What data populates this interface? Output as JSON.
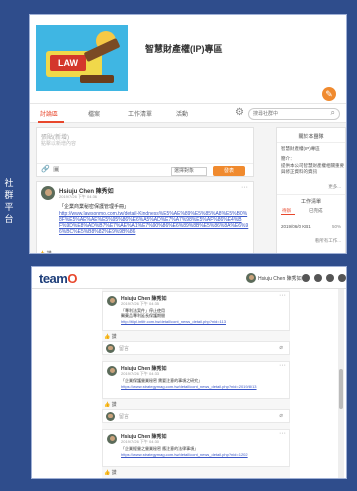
{
  "slide": {
    "side_caption": "社群平台"
  },
  "top": {
    "group_title": "智慧財產權(IP)專區",
    "tabs": [
      "討論區",
      "檔案",
      "工作清單",
      "活動"
    ],
    "search_placeholder": "搜尋社群中",
    "post_box": {
      "placeholder": "張貼(新增)",
      "sub_placeholder": "點擊以新增內容",
      "select_label": "選擇對象",
      "publish_label": "發表"
    },
    "feed_post": {
      "author": "Hsiuju Chen 陳秀如",
      "time": "2019/7/26 下午 04:36",
      "body": "「企業商業秘密保護管理手冊」",
      "link": "http://www.lawsonmo.com.tw/detail-Kindness%E5%AE%89%E5%85%A8%E5%B0%8F%E5%AE%AE%E5%95%86%E6%A5%AD%E7%A7%98%E5%AF%86%E4%BF%9D%E8%AD%B7%E7%AE%A1%E7%90%86%E6%89%8B%E5%86%8A%E6%96%BC%E5%B8%82%E9%9B%86"
    },
    "like_label": "讚",
    "right_panel": {
      "title": "關於本團隊",
      "desc_line1": "智慧財產權(IP)專區",
      "desc_line2": "簡介：",
      "desc_line3": "提供本公司智慧財產權相關重要",
      "desc_line4": "與修正資料的資訊",
      "more": "更多...",
      "task_title": "工作清單",
      "task_tabs": [
        "待辦",
        "已完成"
      ],
      "task_item": "2019/06/0 KB1",
      "task_pct": "50%",
      "task_more": "看所有工作..."
    }
  },
  "bottom": {
    "logo_main": "team",
    "logo_o": "O",
    "user": "Hsiuju Chen 陳秀如",
    "posts": [
      {
        "author": "Hsiuju Chen 陳秀如",
        "time": "2019/7/26 下午 04:35",
        "body1": "「專利法案件」停止使用",
        "body2": "醫藥品專利延長保護期間",
        "link": "http://tiipl.intlfr.com.tw/detail/cont_news_detail.php?nid=113"
      },
      {
        "author": "Hsiuju Chen 陳秀如",
        "time": "2019/7/26 下午 04:33",
        "body1": "「企業保護營業秘密 需要注意的事項之研究」",
        "body2": "",
        "link": "https://www.strategymag.com.tw/detail/cont_news_detail.php?nid=2019/8/13"
      },
      {
        "author": "Hsiuju Chen 陳秀如",
        "time": "2019/7/26 下午 04:30",
        "body1": "「企業經營之營業秘密 應注意的法律事項」",
        "body2": "",
        "link": "https://www.strategymag.com.tw/detail/cont_news_detail.php?nid=1202"
      }
    ],
    "like_label": "讚",
    "comment_placeholder": "留言"
  },
  "colors": {
    "background": "#2f4d8c",
    "accent": "#e8472c",
    "publish": "#f08a2e",
    "link": "#3b57c7"
  }
}
